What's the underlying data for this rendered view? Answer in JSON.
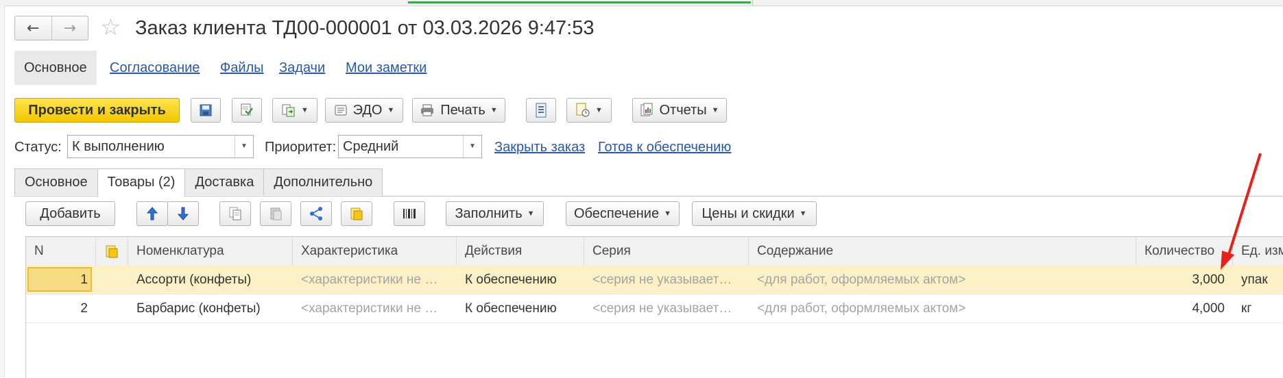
{
  "window": {
    "title": "Заказ клиента ТД00-000001 от 03.03.2026 9:47:53"
  },
  "nav": {
    "back_icon": "←",
    "forward_icon": "→",
    "star_icon": "☆"
  },
  "panel_tabs": [
    {
      "label": "Основное"
    },
    {
      "label": "Согласование"
    },
    {
      "label": "Файлы"
    },
    {
      "label": "Задачи"
    },
    {
      "label": "Мои заметки"
    }
  ],
  "toolbar": {
    "post_close_label": "Провести и закрыть",
    "edo_label": "ЭДО",
    "print_label": "Печать",
    "reports_label": "Отчеты"
  },
  "header_fields": {
    "status_label": "Статус:",
    "status_value": "К выполнению",
    "priority_label": "Приоритет:",
    "priority_value": "Средний",
    "close_order_link": "Закрыть заказ",
    "ready_link": "Готов к обеспечению"
  },
  "inner_tabs": [
    {
      "label": "Основное"
    },
    {
      "label": "Товары (2)"
    },
    {
      "label": "Доставка"
    },
    {
      "label": "Дополнительно"
    }
  ],
  "goods_toolbar": {
    "add_label": "Добавить",
    "fill_label": "Заполнить",
    "supply_label": "Обеспечение",
    "prices_label": "Цены и скидки"
  },
  "table": {
    "columns": [
      "N",
      "Номенклатура",
      "Характеристика",
      "Действия",
      "Серия",
      "Содержание",
      "Количество",
      "Ед. изм"
    ],
    "rows": [
      {
        "n": "1",
        "item": "Ассорти (конфеты)",
        "characteristic": "<характеристики не …",
        "action": "К обеспечению",
        "series": "<серия не указывает…",
        "content": "<для работ, оформляемых актом>",
        "qty": "3,000",
        "unit": "упак"
      },
      {
        "n": "2",
        "item": "Барбарис (конфеты)",
        "characteristic": "<характеристики не …",
        "action": "К обеспечению",
        "series": "<серия не указывает…",
        "content": "<для работ, оформляемых актом>",
        "qty": "4,000",
        "unit": "кг"
      }
    ]
  },
  "colors": {
    "accent_yellow": "#f5d400",
    "link_blue": "#2b57a8",
    "selected_row": "#fbf0c6",
    "annotation_arrow": "#e8201a"
  }
}
